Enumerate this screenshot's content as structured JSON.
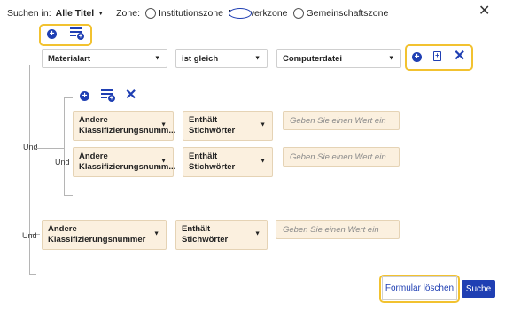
{
  "top": {
    "search_in_label": "Suchen in:",
    "scope_value": "Alle Titel",
    "zone_label": "Zone:",
    "zones": [
      "Institutionszone",
      "Netzwerkzone",
      "Gemeinschaftszone"
    ],
    "selected_zone": "Netzwerkzone",
    "close_glyph": "✕"
  },
  "root_row": {
    "field": "Materialart",
    "operator": "ist gleich",
    "value": "Computerdatei"
  },
  "group": {
    "logic": "Und",
    "rows": [
      {
        "field": "Andere Klassifizierungsnumm...",
        "operator": "Enthält Stichwörter",
        "placeholder": "Geben Sie einen Wert ein"
      },
      {
        "field": "Andere Klassifizierungsnumm...",
        "operator": "Enthält Stichwörter",
        "placeholder": "Geben Sie einen Wert ein"
      }
    ]
  },
  "outer_logic": "Und",
  "bottom_row": {
    "logic": "Und",
    "field": "Andere Klassifizierungsnummer",
    "operator": "Enthält Stichwörter",
    "placeholder": "Geben Sie einen Wert ein"
  },
  "buttons": {
    "clear": "Formular löschen",
    "search": "Suche"
  },
  "colors": {
    "accent": "#1f3fb3",
    "highlight": "#f2c230",
    "field_tan": "#fbf0df"
  }
}
